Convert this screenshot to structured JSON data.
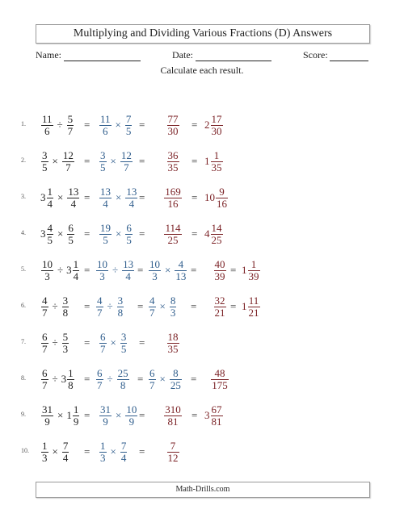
{
  "title": "Multiplying and Dividing Various Fractions (D) Answers",
  "labels": {
    "name": "Name:",
    "date": "Date:",
    "score": "Score:"
  },
  "instruction": "Calculate each result.",
  "footer": "Math-Drills.com",
  "colors": {
    "question": "#222222",
    "steps": "#2f5d8c",
    "answer": "#7b2226"
  },
  "problems": [
    {
      "number": "1.",
      "question": [
        {
          "n": "11",
          "d": "6"
        },
        "÷",
        {
          "n": "5",
          "d": "7"
        }
      ],
      "step1": [
        {
          "n": "11",
          "d": "6"
        },
        "×",
        {
          "n": "7",
          "d": "5"
        }
      ],
      "answer": {
        "n": "77",
        "d": "30"
      },
      "mixed": {
        "w": "2",
        "n": "17",
        "d": "30"
      }
    },
    {
      "number": "2.",
      "question": [
        {
          "n": "3",
          "d": "5"
        },
        "×",
        {
          "n": "12",
          "d": "7"
        }
      ],
      "step1": [
        {
          "n": "3",
          "d": "5"
        },
        "×",
        {
          "n": "12",
          "d": "7"
        }
      ],
      "answer": {
        "n": "36",
        "d": "35"
      },
      "mixed": {
        "w": "1",
        "n": "1",
        "d": "35"
      }
    },
    {
      "number": "3.",
      "question": [
        {
          "w": "3",
          "n": "1",
          "d": "4"
        },
        "×",
        {
          "n": "13",
          "d": "4"
        }
      ],
      "step1": [
        {
          "n": "13",
          "d": "4"
        },
        "×",
        {
          "n": "13",
          "d": "4"
        }
      ],
      "answer": {
        "n": "169",
        "d": "16"
      },
      "mixed": {
        "w": "10",
        "n": "9",
        "d": "16"
      }
    },
    {
      "number": "4.",
      "question": [
        {
          "w": "3",
          "n": "4",
          "d": "5"
        },
        "×",
        {
          "n": "6",
          "d": "5"
        }
      ],
      "step1": [
        {
          "n": "19",
          "d": "5"
        },
        "×",
        {
          "n": "6",
          "d": "5"
        }
      ],
      "answer": {
        "n": "114",
        "d": "25"
      },
      "mixed": {
        "w": "4",
        "n": "14",
        "d": "25"
      }
    },
    {
      "number": "5.",
      "question": [
        {
          "n": "10",
          "d": "3"
        },
        "÷",
        {
          "w": "3",
          "n": "1",
          "d": "4"
        }
      ],
      "step1": [
        {
          "n": "10",
          "d": "3"
        },
        "÷",
        {
          "n": "13",
          "d": "4"
        }
      ],
      "step2": [
        {
          "n": "10",
          "d": "3"
        },
        "×",
        {
          "n": "4",
          "d": "13"
        }
      ],
      "answer": {
        "n": "40",
        "d": "39"
      },
      "mixed": {
        "w": "1",
        "n": "1",
        "d": "39"
      }
    },
    {
      "number": "6.",
      "question": [
        {
          "n": "4",
          "d": "7"
        },
        "÷",
        {
          "n": "3",
          "d": "8"
        }
      ],
      "step1": [
        {
          "n": "4",
          "d": "7"
        },
        "÷",
        {
          "n": "3",
          "d": "8"
        }
      ],
      "step2": [
        {
          "n": "4",
          "d": "7"
        },
        "×",
        {
          "n": "8",
          "d": "3"
        }
      ],
      "answer": {
        "n": "32",
        "d": "21"
      },
      "mixed": {
        "w": "1",
        "n": "11",
        "d": "21"
      }
    },
    {
      "number": "7.",
      "question": [
        {
          "n": "6",
          "d": "7"
        },
        "÷",
        {
          "n": "5",
          "d": "3"
        }
      ],
      "step1": [
        {
          "n": "6",
          "d": "7"
        },
        "×",
        {
          "n": "3",
          "d": "5"
        }
      ],
      "answer": {
        "n": "18",
        "d": "35"
      }
    },
    {
      "number": "8.",
      "question": [
        {
          "n": "6",
          "d": "7"
        },
        "÷",
        {
          "w": "3",
          "n": "1",
          "d": "8"
        }
      ],
      "step1": [
        {
          "n": "6",
          "d": "7"
        },
        "÷",
        {
          "n": "25",
          "d": "8"
        }
      ],
      "step2": [
        {
          "n": "6",
          "d": "7"
        },
        "×",
        {
          "n": "8",
          "d": "25"
        }
      ],
      "answer": {
        "n": "48",
        "d": "175"
      }
    },
    {
      "number": "9.",
      "question": [
        {
          "n": "31",
          "d": "9"
        },
        "×",
        {
          "w": "1",
          "n": "1",
          "d": "9"
        }
      ],
      "step1": [
        {
          "n": "31",
          "d": "9"
        },
        "×",
        {
          "n": "10",
          "d": "9"
        }
      ],
      "answer": {
        "n": "310",
        "d": "81"
      },
      "mixed": {
        "w": "3",
        "n": "67",
        "d": "81"
      }
    },
    {
      "number": "10.",
      "question": [
        {
          "n": "1",
          "d": "3"
        },
        "×",
        {
          "n": "7",
          "d": "4"
        }
      ],
      "step1": [
        {
          "n": "1",
          "d": "3"
        },
        "×",
        {
          "n": "7",
          "d": "4"
        }
      ],
      "answer": {
        "n": "7",
        "d": "12"
      }
    }
  ]
}
